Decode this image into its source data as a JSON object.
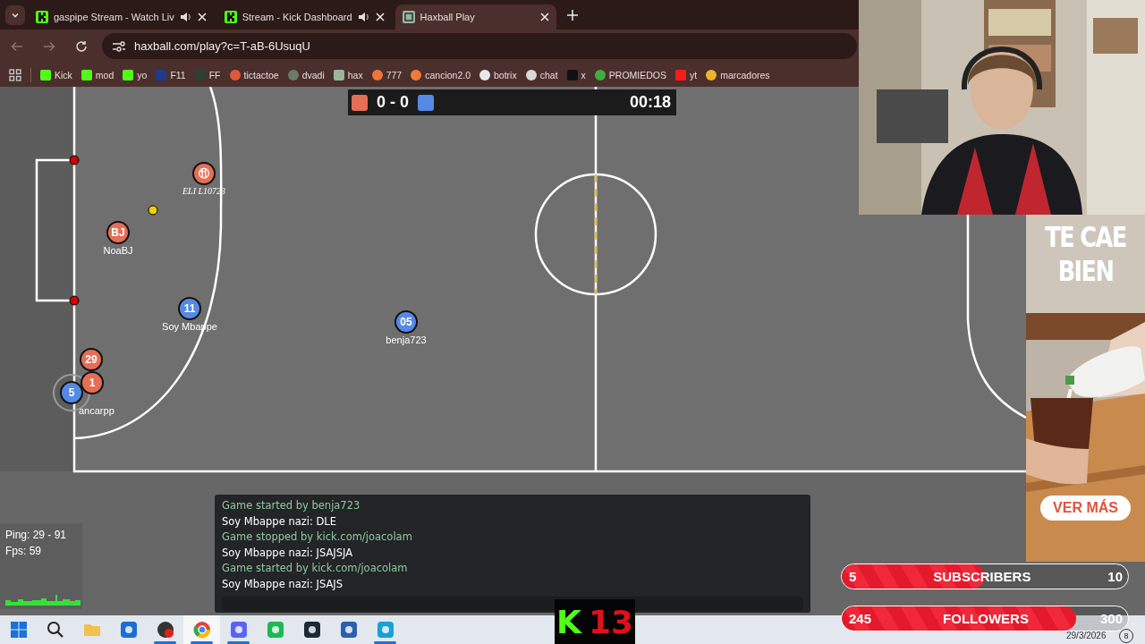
{
  "browser": {
    "tabs": [
      {
        "title": "gaspipe Stream - Watch Liv",
        "audio": true,
        "selected": false
      },
      {
        "title": "Stream - Kick Dashboard",
        "audio": true,
        "selected": false
      },
      {
        "title": "Haxball Play",
        "audio": false,
        "selected": true
      }
    ],
    "address": "haxball.com/play?c=T-aB-6UsuqU",
    "bookmarks": [
      {
        "label": "Kick",
        "color": "#53fc18"
      },
      {
        "label": "mod",
        "color": "#53fc18"
      },
      {
        "label": "yo",
        "color": "#53fc18"
      },
      {
        "label": "F11",
        "color": "#1f3a8a"
      },
      {
        "label": "FF",
        "color": "#2e4030"
      },
      {
        "label": "tictactoe",
        "color": "#e0583a"
      },
      {
        "label": "dvadi",
        "color": "#6b7a6a"
      },
      {
        "label": "hax",
        "color": "#9bb59a"
      },
      {
        "label": "777",
        "color": "#f0753a"
      },
      {
        "label": "cancion2.0",
        "color": "#f07a3a"
      },
      {
        "label": "botrix",
        "color": "#e8e8e8"
      },
      {
        "label": "chat",
        "color": "#d8d8d8"
      },
      {
        "label": "x",
        "color": "#111111"
      },
      {
        "label": "PROMIEDOS",
        "color": "#3fae3f"
      },
      {
        "label": "yt",
        "color": "#ff1a1a"
      },
      {
        "label": "marcadores",
        "color": "#f0b030"
      }
    ]
  },
  "game": {
    "score": {
      "red": "0",
      "separator": "-",
      "blue": "0",
      "time": "00:18"
    },
    "players": [
      {
        "number": "⑪",
        "name": "ELI  L10723",
        "color": "#e56e56"
      },
      {
        "number": "BJ",
        "name": "NoaBJ",
        "color": "#e56e56"
      },
      {
        "number": "11",
        "name": "Soy Mbappe",
        "color": "#5689e5"
      },
      {
        "number": "05",
        "name": "benja723",
        "color": "#5689e5"
      },
      {
        "number": "29",
        "color": "#e56e56"
      },
      {
        "number": "1",
        "color": "#e56e56"
      },
      {
        "number": "5",
        "name": "ancarpp",
        "color": "#5689e5"
      }
    ],
    "chat": [
      {
        "text": "Game started by benja723",
        "kind": "notice"
      },
      {
        "text": "Soy Mbappe nazi: DLE",
        "kind": "message"
      },
      {
        "text": "Game stopped by kick.com/joacolam",
        "kind": "notice"
      },
      {
        "text": "Soy Mbappe nazi: JSAJSJA",
        "kind": "message"
      },
      {
        "text": "Game started by kick.com/joacolam",
        "kind": "notice"
      },
      {
        "text": "Soy Mbappe nazi: JSAJS",
        "kind": "message"
      }
    ],
    "stats": {
      "ping": "Ping: 29 - 91",
      "fps": "Fps: 59"
    }
  },
  "ad": {
    "headline": [
      "TE CAE",
      "BIEN"
    ],
    "button": "VER MÁS"
  },
  "goals": [
    {
      "count": "5",
      "label": "SUBSCRIBERS",
      "target": "10",
      "level": 0.5
    },
    {
      "count": "245",
      "label": "FOLLOWERS",
      "target": "300",
      "level": 0.82
    }
  ],
  "logo": {
    "letter": "K",
    "number": "13"
  },
  "taskbar": {
    "apps": [
      {
        "kind": "start",
        "running": false,
        "selected": false
      },
      {
        "kind": "search",
        "running": false,
        "selected": false
      },
      {
        "kind": "folder",
        "running": false,
        "selected": false
      },
      {
        "kind": "mail",
        "running": false,
        "selected": false
      },
      {
        "kind": "record",
        "running": true,
        "selected": false
      },
      {
        "kind": "browser",
        "running": true,
        "selected": true
      },
      {
        "kind": "chat",
        "running": true,
        "selected": false
      },
      {
        "kind": "music",
        "running": false,
        "selected": false
      },
      {
        "kind": "steam",
        "running": false,
        "selected": false
      },
      {
        "kind": "tool",
        "running": false,
        "selected": false
      },
      {
        "kind": "edge",
        "running": true,
        "selected": false
      }
    ],
    "date": "29/3/2026",
    "notifications": "8"
  }
}
